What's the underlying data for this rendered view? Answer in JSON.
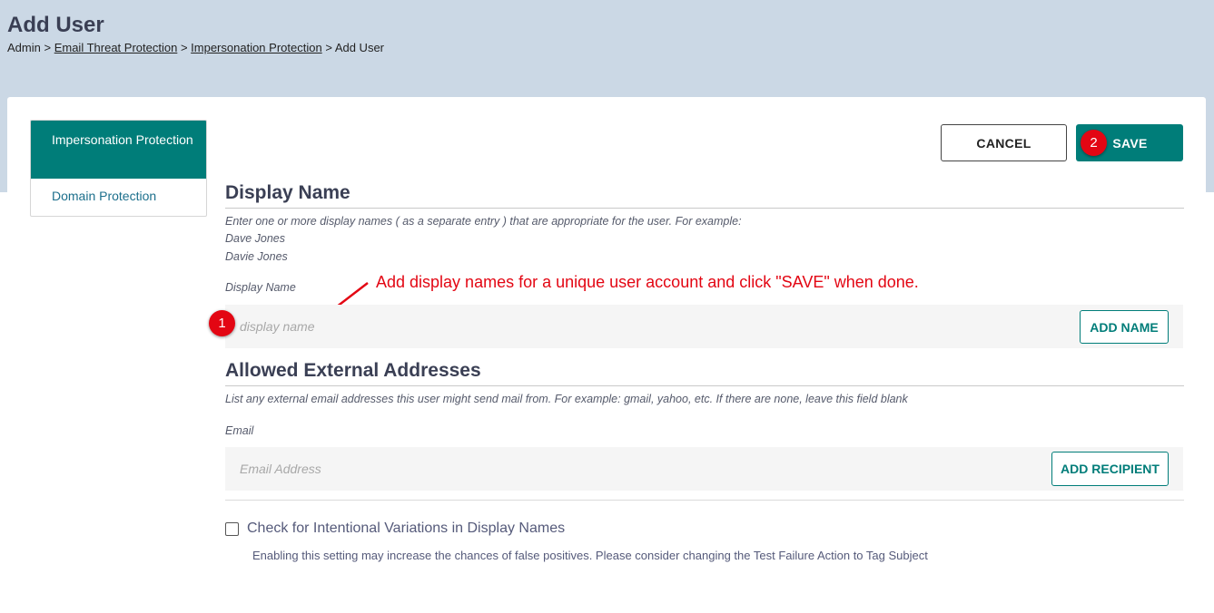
{
  "page": {
    "title": "Add User",
    "breadcrumb": {
      "root": "Admin",
      "sep": ">",
      "link1": "Email Threat Protection",
      "link2": "Impersonation Protection",
      "current": "Add User"
    }
  },
  "sidebar": {
    "items": [
      {
        "label": "Impersonation Protection",
        "active": true
      },
      {
        "label": "Domain Protection",
        "active": false
      }
    ]
  },
  "actions": {
    "cancel_label": "CANCEL",
    "save_label": "SAVE"
  },
  "display_name": {
    "title": "Display Name",
    "help": "Enter one or more display names ( as a separate entry ) that are appropriate for the user. For example:",
    "examples": [
      "Dave Jones",
      "Davie Jones"
    ],
    "field_label": "Display Name",
    "placeholder": "display name",
    "add_label": "ADD NAME"
  },
  "allowed": {
    "title": "Allowed External Addresses",
    "help": "List any external email addresses this user might send mail from. For example: gmail, yahoo, etc. If there are none, leave this field blank",
    "field_label": "Email",
    "placeholder": "Email Address",
    "add_label": "ADD RECIPIENT"
  },
  "variations": {
    "label": "Check for Intentional Variations in Display Names",
    "checked": false,
    "help": "Enabling this setting may increase the chances of false positives. Please consider changing the Test Failure Action to Tag Subject"
  },
  "annotations": {
    "marker1": "1",
    "marker2": "2",
    "note": "Add display names for a unique user account and click \"SAVE\" when done."
  },
  "colors": {
    "header_bg": "#cbd8e5",
    "accent": "#007d79",
    "annotation": "#e30613"
  }
}
